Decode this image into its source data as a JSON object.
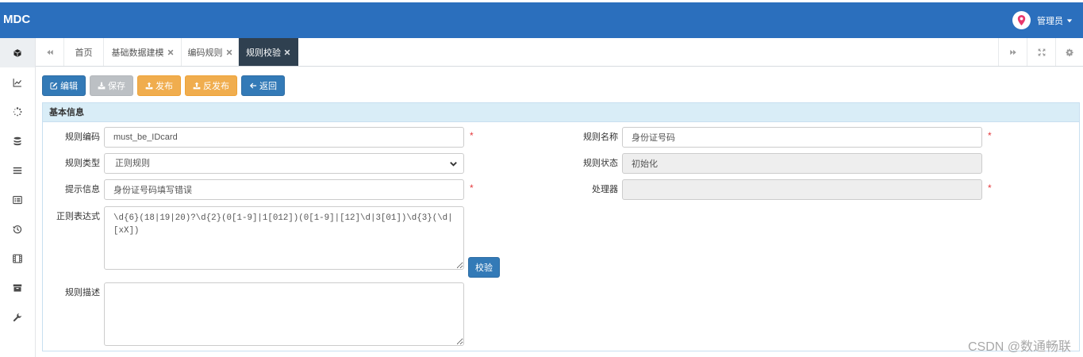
{
  "header": {
    "logo": "MDC",
    "user_name": "管理员",
    "avatar_icon": "map-marker-icon",
    "caret_icon": "caret-down-icon",
    "brand_color": "#2b6fbd"
  },
  "sidebar": {
    "items": [
      {
        "icon": "cube-icon",
        "active": true
      },
      {
        "icon": "line-chart-icon"
      },
      {
        "icon": "spinner-icon"
      },
      {
        "icon": "database-icon"
      },
      {
        "icon": "bars-icon"
      },
      {
        "icon": "list-alt-icon"
      },
      {
        "icon": "history-icon"
      },
      {
        "icon": "film-icon"
      },
      {
        "icon": "archive-icon"
      },
      {
        "icon": "wrench-icon"
      }
    ]
  },
  "tabs": {
    "scroll_left_icon": "backward-icon",
    "items": [
      {
        "label": "首页",
        "closable": false,
        "active": false
      },
      {
        "label": "基础数据建模",
        "closable": true,
        "active": false
      },
      {
        "label": "编码规则",
        "closable": true,
        "active": false
      },
      {
        "label": "规则校验",
        "closable": true,
        "active": true
      }
    ],
    "scroll_right_icon": "forward-icon",
    "fullscreen_icon": "expand-icon",
    "settings_icon": "gear-icon",
    "active_color": "#2f4050"
  },
  "toolbar": {
    "buttons": [
      {
        "label": "编辑",
        "icon": "edit-icon",
        "color": "#337ab7"
      },
      {
        "label": "保存",
        "icon": "download-icon",
        "color": "#bcc0c4",
        "disabled": true
      },
      {
        "label": "发布",
        "icon": "upload-icon",
        "color": "#f0ad4e"
      },
      {
        "label": "反发布",
        "icon": "upload-icon",
        "color": "#f0ad4e"
      },
      {
        "label": "返回",
        "icon": "arrow-left-icon",
        "color": "#337ab7"
      }
    ]
  },
  "panel": {
    "title": "基本信息",
    "header_color": "#d9edf7",
    "required_mark": "*",
    "validate_button": "校验",
    "fields": {
      "rule_code": {
        "label": "规则编码",
        "value": "must_be_IDcard",
        "required": true
      },
      "rule_name": {
        "label": "规则名称",
        "value": "身份证号码",
        "required": true
      },
      "rule_type": {
        "label": "规则类型",
        "value": "正则规则"
      },
      "rule_status": {
        "label": "规则状态",
        "value": "初始化",
        "disabled": true
      },
      "hint": {
        "label": "提示信息",
        "value": "身份证号码填写错误",
        "required": true
      },
      "handler": {
        "label": "处理器",
        "value": "",
        "disabled": true,
        "required": true
      },
      "regex": {
        "label": "正则表达式",
        "value": "\\d{6}(18|19|20)?\\d{2}(0[1-9]|1[012])(0[1-9]|[12]\\d|3[01])\\d{3}(\\d|[xX])"
      },
      "description": {
        "label": "规则描述",
        "value": ""
      }
    }
  },
  "watermark": "CSDN @数通畅联"
}
